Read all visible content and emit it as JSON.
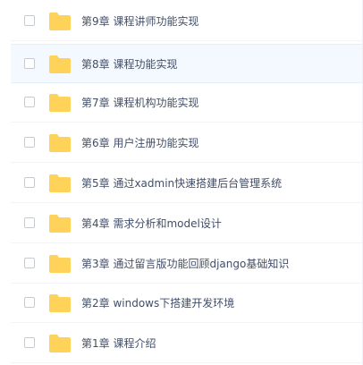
{
  "file_list": {
    "folder_icon": "folder-icon",
    "colors": {
      "folder": "#ffd35a",
      "text": "#424e67",
      "hover_row": "#f3f9ff"
    },
    "items": [
      {
        "name": "第9章 课程讲师功能实现"
      },
      {
        "name": "第8章 课程功能实现"
      },
      {
        "name": "第7章 课程机构功能实现"
      },
      {
        "name": "第6章 用户注册功能实现"
      },
      {
        "name": "第5章 通过xadmin快速搭建后台管理系统"
      },
      {
        "name": "第4章 需求分析和model设计"
      },
      {
        "name": "第3章 通过留言版功能回顾django基础知识"
      },
      {
        "name": "第2章 windows下搭建开发环境"
      },
      {
        "name": "第1章 课程介绍"
      }
    ]
  }
}
